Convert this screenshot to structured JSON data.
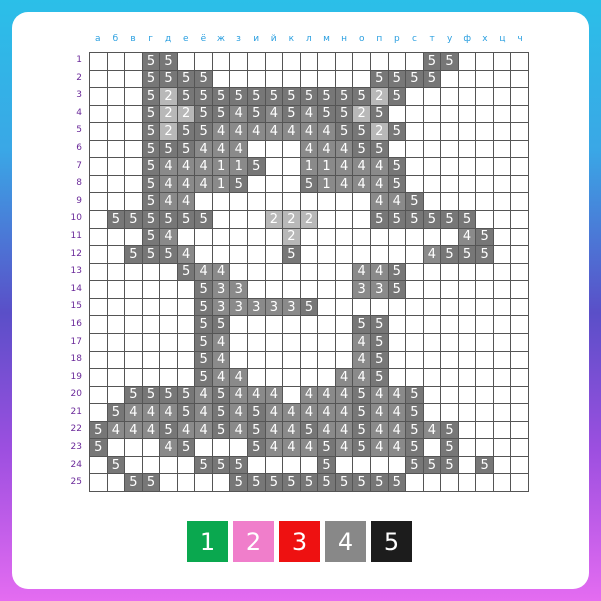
{
  "columns": [
    "а",
    "б",
    "в",
    "г",
    "д",
    "е",
    "ё",
    "ж",
    "з",
    "и",
    "й",
    "к",
    "л",
    "м",
    "н",
    "о",
    "п",
    "р",
    "с",
    "т",
    "у",
    "ф",
    "х",
    "ц",
    "ч"
  ],
  "rows": [
    "1",
    "2",
    "3",
    "4",
    "5",
    "6",
    "7",
    "8",
    "9",
    "10",
    "11",
    "12",
    "13",
    "14",
    "15",
    "16",
    "17",
    "18",
    "19",
    "20",
    "21",
    "22",
    "23",
    "24",
    "25"
  ],
  "grid": [
    "...55..............55....",
    "...5555.........5555.....",
    "...525555555555525.......",
    "...52255454545525........",
    "...525544444445525.......",
    "...555444...44455........",
    "...5444115..114445.......",
    "...544415...514445.......",
    "...544..........445......",
    ".555555...222...555555...",
    "...54......2.........45..",
    "..5554.....5.......4555..",
    ".....544.......445.......",
    "......533......335.......",
    "......5333335............",
    "......55.......55........",
    "......54.......45........",
    "......54.......45........",
    "......544.....445........",
    "..555545444.4445445......",
    ".544454545444445445......",
    "544454454544544544545....",
    "5...45...5444545445.5....",
    ".5....555....5....555.5..",
    "..55....5555555555......."
  ],
  "palette": [
    {
      "label": "1",
      "color": "#0aa84f"
    },
    {
      "label": "2",
      "color": "#f07ecb"
    },
    {
      "label": "3",
      "color": "#ee1111"
    },
    {
      "label": "4",
      "color": "#888888"
    },
    {
      "label": "5",
      "color": "#1c1c1c"
    }
  ]
}
